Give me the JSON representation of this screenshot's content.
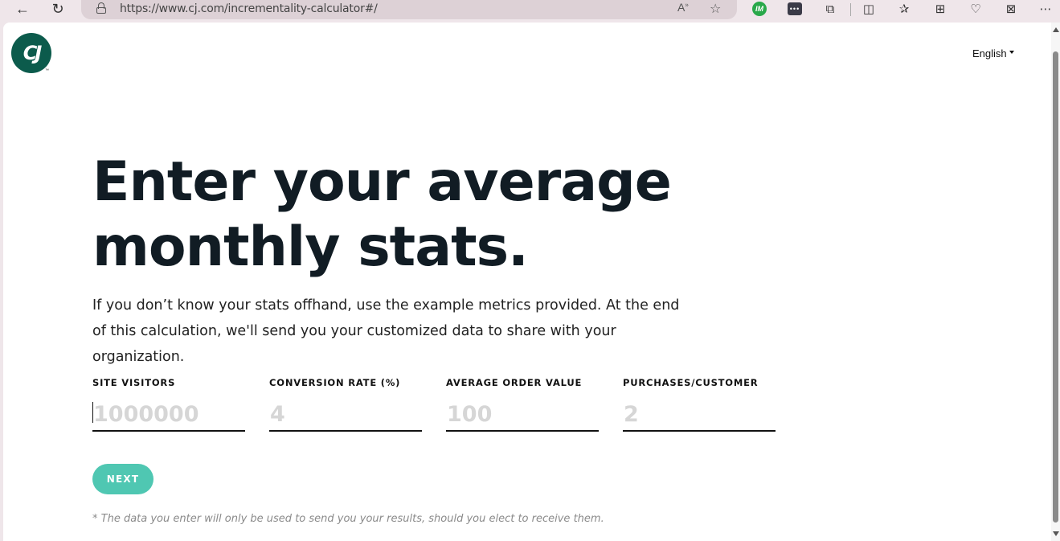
{
  "browser": {
    "url": "https://www.cj.com/incrementality-calculator#/",
    "icons": [
      "back-icon",
      "refresh-icon",
      "lock-icon",
      "read-aloud-icon",
      "favorite-star-icon",
      "im-extension-icon",
      "dots-extension-icon",
      "extensions-icon",
      "split-screen-icon",
      "favorites-icon",
      "collections-icon",
      "heart-pulse-icon",
      "screenshot-icon",
      "more-icon"
    ],
    "im_label": "IM"
  },
  "header": {
    "logo_text": "CJ",
    "trademark": "™",
    "language": "English"
  },
  "main": {
    "headline": "Enter your average monthly stats.",
    "intro": "If you don’t know your stats offhand, use the example metrics provided. At the end of this calculation, we'll send you your customized data to share with your organization.",
    "fields": [
      {
        "label": "SITE VISITORS",
        "placeholder": "1000000",
        "value": ""
      },
      {
        "label": "CONVERSION RATE (%)",
        "placeholder": "4",
        "value": ""
      },
      {
        "label": "AVERAGE ORDER VALUE",
        "placeholder": "100",
        "value": ""
      },
      {
        "label": "PURCHASES/CUSTOMER",
        "placeholder": "2",
        "value": ""
      }
    ],
    "next_label": "NEXT",
    "disclaimer": "* The data you enter will only be used to send you your results, should you elect to receive them."
  }
}
